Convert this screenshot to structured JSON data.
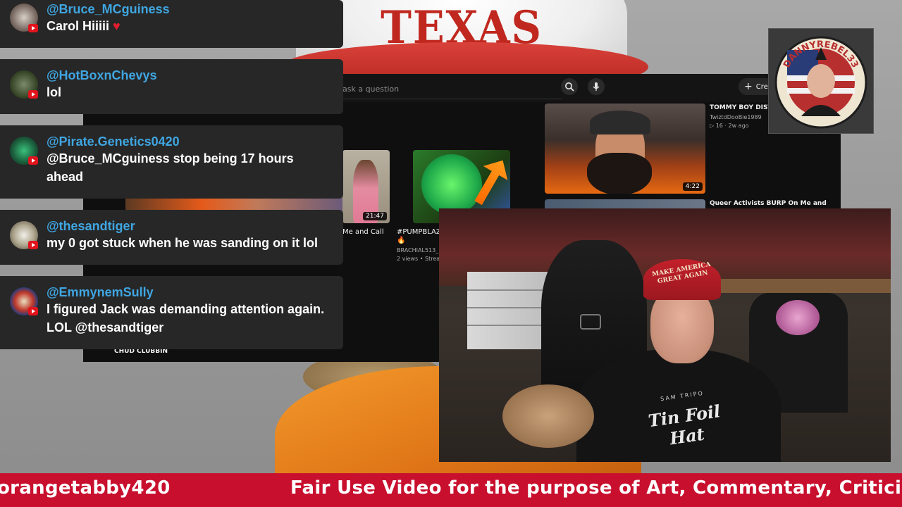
{
  "background": {
    "hat_text": "TEXAS"
  },
  "youtube": {
    "search_placeholder": "ask a question",
    "create_label": "Crea",
    "videos": [
      {
        "title": "TOMMY BOY DISTRA",
        "channel": "TwiztdDooBie1989",
        "meta": "▷ 16 · 2w ago",
        "duration": "4:22"
      },
      {
        "title": "Queer Activists BURP On Me and"
      },
      {
        "title": "Me and Call",
        "duration": "21:47"
      },
      {
        "title": "#PUMPBLAZ",
        "emoji": "🔥",
        "channel": "BRACHIAL513_",
        "meta": "2 views • Strean"
      },
      {
        "title": "CHUD CLUBBIN"
      }
    ]
  },
  "channel_logo": {
    "text": "DANNYREBEL33"
  },
  "webcam": {
    "cap_text": "MAKE AMERICA GREAT AGAIN",
    "shirt_small": "SAM TRIPO",
    "shirt_text": "Tin Foil Hat"
  },
  "chat": {
    "messages": [
      {
        "author": "@Bruce_MCguiness",
        "text": "Carol Hiiiii",
        "emoji": "♥"
      },
      {
        "author": "@HotBoxnChevys",
        "text": "lol"
      },
      {
        "author": "@Pirate.Genetics0420",
        "text": "@Bruce_MCguiness stop being 17 hours ahead"
      },
      {
        "author": "@thesandtiger",
        "text": "my 0 got stuck when he was sanding on it lol"
      },
      {
        "author": "@EmmynemSully",
        "text": "I figured Jack was demanding attention again. LOL @thesandtiger"
      }
    ]
  },
  "ticker": {
    "left_text": "orangetabby420",
    "right_text": "Fair Use Video for the purpose of Art, Commentary, Criticism, Se"
  },
  "colors": {
    "ticker_bg": "#c8102e",
    "chat_bg": "#272727",
    "author": "#3fa6e2",
    "youtube_red": "#e1141d"
  }
}
